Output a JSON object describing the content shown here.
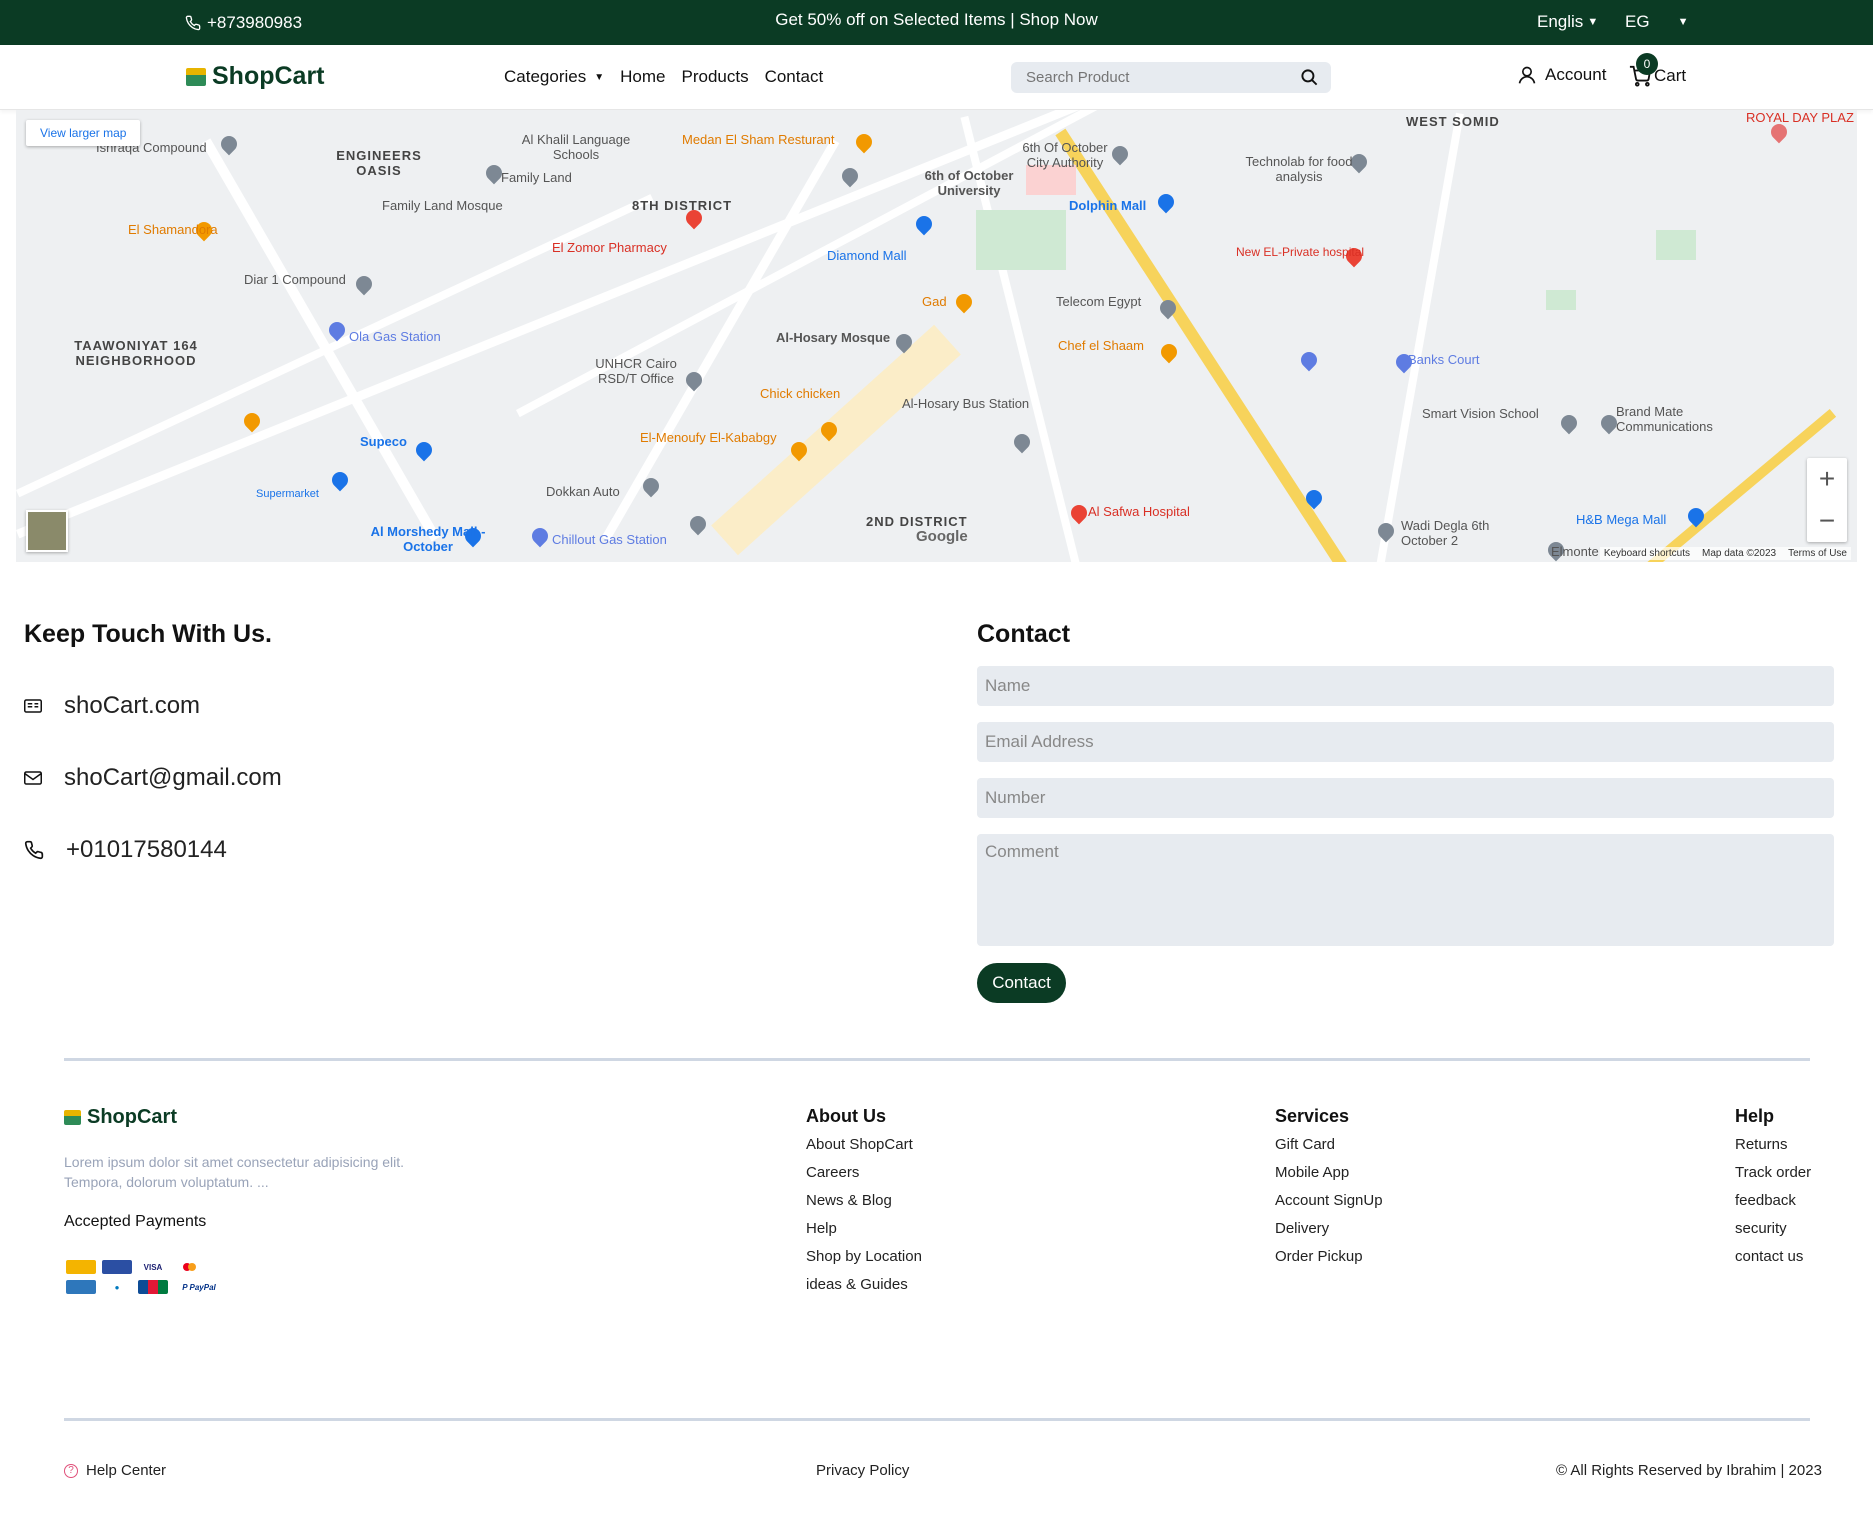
{
  "topbar": {
    "phone": "+873980983",
    "promo": "Get 50% off on Selected Items | Shop Now",
    "language": "Englis",
    "region": "EG"
  },
  "header": {
    "logo": "ShopCart",
    "nav": [
      "Categories",
      "Home",
      "Products",
      "Contact"
    ],
    "search_placeholder": "Search Product",
    "account": "Account",
    "cart": "Cart",
    "cart_count": "0"
  },
  "map": {
    "larger_map": "View larger map",
    "attribution": [
      "Keyboard shortcuts",
      "Map data ©2023",
      "Terms of Use"
    ],
    "labels": [
      "Ishraqa Compound",
      "ENGINEERS OASIS",
      "Al Khalil Language Schools",
      "Family Land",
      "Medan El Sham Resturant",
      "8TH DISTRICT",
      "6th of October University",
      "6th Of October City Authority",
      "WEST SOMID",
      "Technolab for food analysis",
      "ROYAL DAY PLAZ",
      "El Shamandora",
      "El Zomor Pharmacy",
      "Dolphin Mall",
      "Diamond Mall",
      "Family Land Mosque",
      "Diar 1 Compound",
      "Telecom Egypt",
      "Ola Gas Station",
      "TAAWONIYAT 164 NEIGHBORHOOD",
      "Gad",
      "Al-Hosary Mosque",
      "New EL-Private hospital",
      "UNHCR Cairo RSD/T Office",
      "Chef el Shaam",
      "Banks Court",
      "Chick chicken",
      "Al-Hosary Bus Station",
      "Smart Vision School",
      "Brand Mate Communications",
      "Supeco",
      "El-Menoufy El-Kababgy",
      "Supermarket",
      "Dokkan Auto",
      "Al Safwa Hospital",
      "Al Morshedy Mall - October",
      "Chillout Gas Station",
      "2ND DISTRICT",
      "H&B Mega Mall",
      "Wadi Degla 6th October 2",
      "Elmonte"
    ]
  },
  "contact_info": {
    "title": "Keep Touch With Us.",
    "website": "shoCart.com",
    "email": "shoCart@gmail.com",
    "phone": "+01017580144"
  },
  "contact_form": {
    "title": "Contact",
    "name_placeholder": "Name",
    "email_placeholder": "Email Address",
    "number_placeholder": "Number",
    "comment_placeholder": "Comment",
    "submit": "Contact"
  },
  "footer": {
    "logo": "ShopCart",
    "lorem": "Lorem ipsum dolor sit amet consectetur adipisicing elit. Tempora, dolorum voluptatum. ...",
    "accepted_payments": "Accepted Payments",
    "columns": [
      {
        "title": "About Us",
        "items": [
          "About ShopCart",
          "Careers",
          "News & Blog",
          "Help",
          "Shop by Location",
          "ideas & Guides"
        ]
      },
      {
        "title": "Services",
        "items": [
          "Gift Card",
          "Mobile App",
          "Account SignUp",
          "Delivery",
          "Order Pickup"
        ]
      },
      {
        "title": "Help",
        "items": [
          "Returns",
          "Track order",
          "feedback",
          "security",
          "contact us"
        ]
      }
    ],
    "help_center": "Help Center",
    "privacy": "Privacy Policy",
    "copyright": "© All Rights Reserved by Ibrahim | 2023"
  },
  "colors": {
    "brand": "#0b3b24",
    "input_bg": "#e7ebf0"
  }
}
